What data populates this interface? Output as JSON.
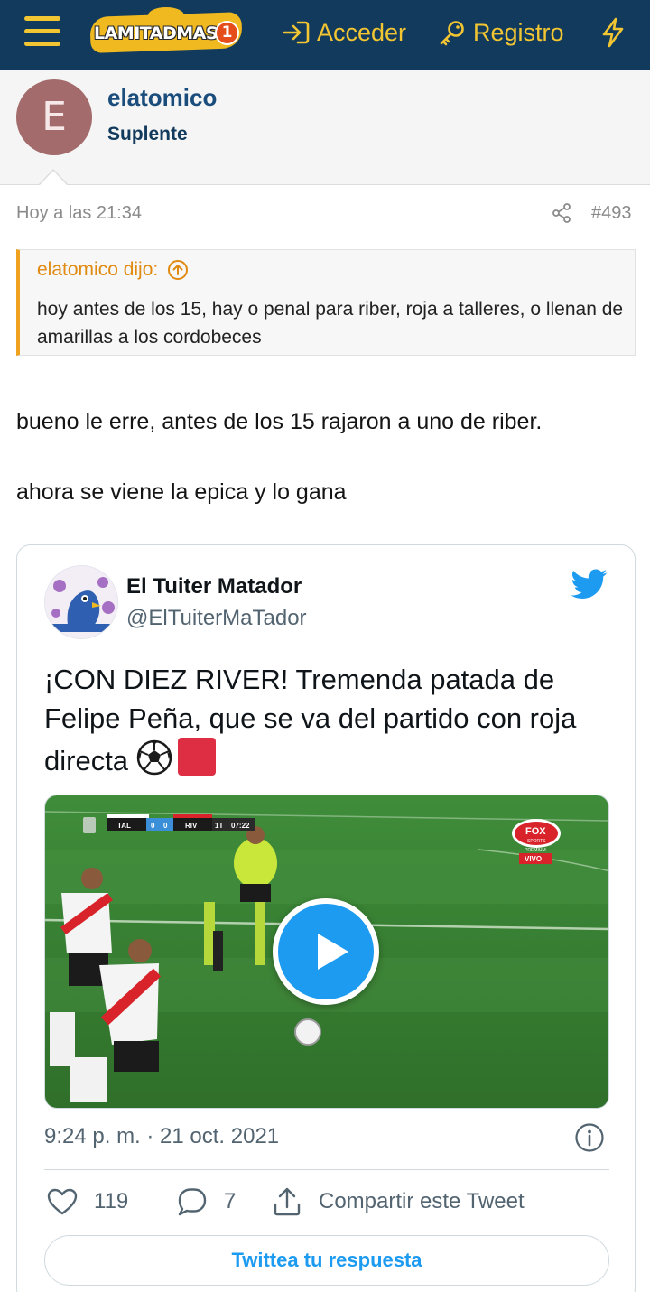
{
  "header": {
    "logo_text": "LAMITADMAS",
    "logo_number": "1",
    "login_label": "Acceder",
    "register_label": "Registro",
    "icons": {
      "menu": "hamburger-icon",
      "login": "sign-in-icon",
      "register": "key-icon",
      "whats_new": "bolt-icon"
    },
    "colors": {
      "bar": "#123a5c",
      "accent": "#f2c533"
    }
  },
  "author": {
    "avatar_letter": "E",
    "username": "elatomico",
    "user_title": "Suplente",
    "avatar_color": "#a36b6b"
  },
  "post": {
    "date": "Hoy a las 21:34",
    "number": "#493",
    "quote": {
      "attribution": "elatomico dijo:",
      "text": "hoy antes de los 15, hay o penal para riber, roja a talleres, o llenan de amarillas a los cordobeces"
    },
    "paragraphs": [
      "bueno le erre, antes de los 15 rajaron a uno de riber.",
      "ahora se viene la epica y lo gana"
    ]
  },
  "tweet": {
    "display_name": "El Tuiter Matador",
    "handle": "@ElTuiterMaTador",
    "text": "¡CON DIEZ RIVER! Tremenda patada de Felipe Peña, que se va del partido con roja directa",
    "video": {
      "score_home": "TAL",
      "score_home_goals": "0",
      "score_away_goals": "0",
      "score_away": "RIV",
      "period": "1T",
      "clock": "07:22",
      "broadcaster": "FOX",
      "broadcaster_sub": "SPORTS",
      "broadcaster_tier": "PREMIUM",
      "live_label": "VIVO"
    },
    "timestamp": "9:24 p. m. · 21 oct. 2021",
    "likes": "119",
    "replies": "7",
    "share_label": "Compartir este Tweet",
    "reply_button_label": "Twittea tu respuesta",
    "avatar_caption": "@ElTuiterMatador",
    "brand_color": "#1d9bf0"
  }
}
